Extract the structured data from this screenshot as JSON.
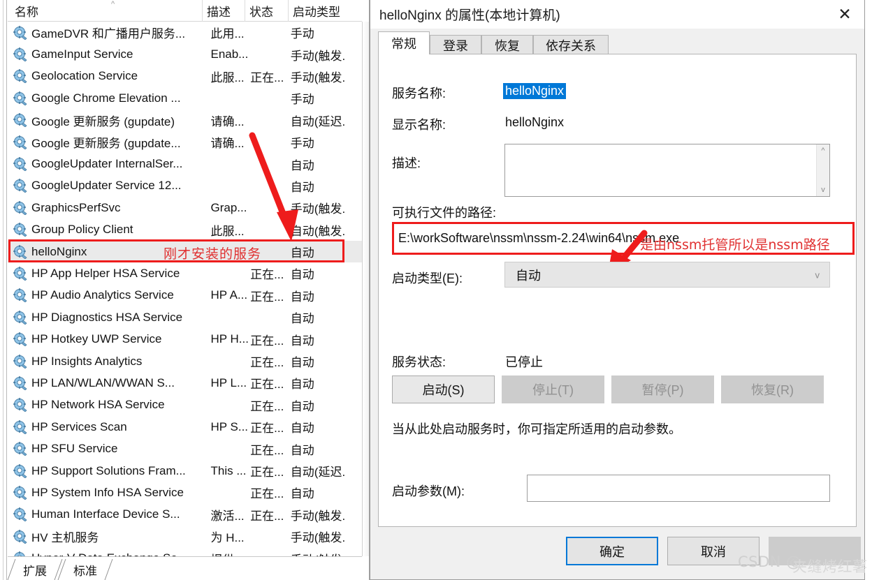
{
  "services_panel": {
    "columns": [
      {
        "label": "名称",
        "key": "name"
      },
      {
        "label": "描述",
        "key": "description"
      },
      {
        "label": "状态",
        "key": "status"
      },
      {
        "label": "启动类型",
        "key": "startup_type"
      }
    ],
    "sort_indicator": "^",
    "row_icon": "service-gear-icon",
    "rows": [
      {
        "name": "GameDVR 和广播用户服务...",
        "description": "此用...",
        "status": "",
        "startup_type": "手动"
      },
      {
        "name": "GameInput Service",
        "description": "Enab...",
        "status": "",
        "startup_type": "手动(触发."
      },
      {
        "name": "Geolocation Service",
        "description": "此服...",
        "status": "正在...",
        "startup_type": "手动(触发."
      },
      {
        "name": "Google Chrome Elevation ...",
        "description": "",
        "status": "",
        "startup_type": "手动"
      },
      {
        "name": "Google 更新服务 (gupdate)",
        "description": "请确...",
        "status": "",
        "startup_type": "自动(延迟."
      },
      {
        "name": "Google 更新服务 (gupdate...",
        "description": "请确...",
        "status": "",
        "startup_type": "手动"
      },
      {
        "name": "GoogleUpdater InternalSer...",
        "description": "",
        "status": "",
        "startup_type": "自动"
      },
      {
        "name": "GoogleUpdater Service 12...",
        "description": "",
        "status": "",
        "startup_type": "自动"
      },
      {
        "name": "GraphicsPerfSvc",
        "description": "Grap...",
        "status": "",
        "startup_type": "手动(触发."
      },
      {
        "name": "Group Policy Client",
        "description": "此服...",
        "status": "",
        "startup_type": "自动(触发."
      },
      {
        "name": "helloNginx",
        "description": "",
        "status": "",
        "startup_type": "自动",
        "selected": true
      },
      {
        "name": "HP App Helper HSA Service",
        "description": "",
        "status": "正在...",
        "startup_type": "自动"
      },
      {
        "name": "HP Audio Analytics Service",
        "description": "HP A...",
        "status": "正在...",
        "startup_type": "自动"
      },
      {
        "name": "HP Diagnostics HSA Service",
        "description": "",
        "status": "",
        "startup_type": "自动"
      },
      {
        "name": "HP Hotkey UWP Service",
        "description": "HP H...",
        "status": "正在...",
        "startup_type": "自动"
      },
      {
        "name": "HP Insights Analytics",
        "description": "",
        "status": "正在...",
        "startup_type": "自动"
      },
      {
        "name": "HP LAN/WLAN/WWAN S...",
        "description": "HP L...",
        "status": "正在...",
        "startup_type": "自动"
      },
      {
        "name": "HP Network HSA Service",
        "description": "",
        "status": "正在...",
        "startup_type": "自动"
      },
      {
        "name": "HP Services Scan",
        "description": "HP S...",
        "status": "正在...",
        "startup_type": "自动"
      },
      {
        "name": "HP SFU Service",
        "description": "",
        "status": "正在...",
        "startup_type": "自动"
      },
      {
        "name": "HP Support Solutions Fram...",
        "description": "This ...",
        "status": "正在...",
        "startup_type": "自动(延迟."
      },
      {
        "name": "HP System Info HSA Service",
        "description": "",
        "status": "正在...",
        "startup_type": "自动"
      },
      {
        "name": "Human Interface Device S...",
        "description": "激活...",
        "status": "正在...",
        "startup_type": "手动(触发."
      },
      {
        "name": "HV 主机服务",
        "description": "为 H...",
        "status": "",
        "startup_type": "手动(触发."
      },
      {
        "name": "Hyper-V Data Exchange Se...",
        "description": "提供...",
        "status": "",
        "startup_type": "手动(触发."
      }
    ],
    "view_tabs": [
      {
        "label": "扩展"
      },
      {
        "label": "标准"
      }
    ],
    "annotation": {
      "text": "刚才安装的服务",
      "color": "#e03030",
      "arrow": "red-arrow-down-right",
      "highlight_box_color": "#ee1c1c"
    }
  },
  "dialog": {
    "title": "helloNginx 的属性(本地计算机)",
    "close_label": "✕",
    "tabs": [
      {
        "label": "常规",
        "active": true
      },
      {
        "label": "登录",
        "active": false
      },
      {
        "label": "恢复",
        "active": false
      },
      {
        "label": "依存关系",
        "active": false
      }
    ],
    "fields": {
      "service_name_label": "服务名称:",
      "service_name_value": "helloNginx",
      "display_name_label": "显示名称:",
      "display_name_value": "helloNginx",
      "description_label": "描述:",
      "description_value": "",
      "path_label": "可执行文件的路径:",
      "path_value": "E:\\workSoftware\\nssm\\nssm-2.24\\win64\\nssm.exe",
      "startup_type_label": "启动类型(E):",
      "startup_type_value": "自动",
      "service_status_label": "服务状态:",
      "service_status_value": "已停止",
      "hint_text": "当从此处启动服务时，你可指定所适用的启动参数。",
      "start_params_label": "启动参数(M):",
      "start_params_value": ""
    },
    "control_buttons": [
      {
        "label": "启动(S)",
        "enabled": true
      },
      {
        "label": "停止(T)",
        "enabled": false
      },
      {
        "label": "暂停(P)",
        "enabled": false
      },
      {
        "label": "恢复(R)",
        "enabled": false
      }
    ],
    "footer_buttons": [
      {
        "label": "确定",
        "enabled": true,
        "primary": true
      },
      {
        "label": "取消",
        "enabled": true,
        "primary": false
      },
      {
        "label": "",
        "enabled": false,
        "primary": false
      }
    ],
    "annotation": {
      "text": "是由nssm托管所以是nssm路径",
      "color": "#e03030",
      "arrow": "red-arrow-down-left",
      "highlight_box_color": "#ee1c1c"
    },
    "scroll_up_arrow": "^",
    "scroll_down_arrow": "v",
    "dropdown_chevron": "v"
  },
  "watermark": {
    "prefix": "CSDN @",
    "author": "夹缝烤红薯"
  }
}
